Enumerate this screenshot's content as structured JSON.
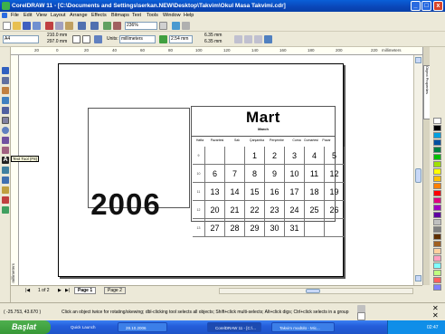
{
  "window": {
    "title": "CorelDRAW 11 - [C:\\Documents and Settings\\serkan.NEW\\Desktop\\Takvim\\Okul Masa Takvimi.cdr]",
    "minimize": "_",
    "maximize": "□",
    "close": "x"
  },
  "menu": [
    "File",
    "Edit",
    "View",
    "Layout",
    "Arrange",
    "Effects",
    "Bitmaps",
    "Text",
    "Tools",
    "Window",
    "Help"
  ],
  "toolbar": {
    "zoom": "236%",
    "paper": "A4",
    "width": "210.0 mm",
    "height": "297.0 mm",
    "units_label": "Units:",
    "units_value": "millimeters",
    "nudge": "2.54 mm",
    "dup_x": "6.35 mm",
    "dup_y": "6.35 mm"
  },
  "ruler": {
    "h_labels": [
      "20",
      "0",
      "20",
      "40",
      "60",
      "80",
      "100",
      "120",
      "140",
      "160",
      "180",
      "200",
      "220"
    ],
    "unit": "millimeters",
    "v_label": "millimeters"
  },
  "calendar": {
    "month": "Mart",
    "month_sub": "March",
    "day_names": [
      "Hafta",
      "Pazartesi",
      "Salı",
      "Çarşamba",
      "Perşembe",
      "Cuma",
      "Cumartesi",
      "Pazar"
    ],
    "weeks": [
      {
        "week": "9",
        "days": [
          "",
          "",
          "1",
          "2",
          "3",
          "4",
          "5"
        ]
      },
      {
        "week": "10",
        "days": [
          "6",
          "7",
          "8",
          "9",
          "10",
          "11",
          "12"
        ]
      },
      {
        "week": "11",
        "days": [
          "13",
          "14",
          "15",
          "16",
          "17",
          "18",
          "19"
        ]
      },
      {
        "week": "12",
        "days": [
          "20",
          "21",
          "22",
          "23",
          "24",
          "25",
          "26"
        ]
      },
      {
        "week": "13",
        "days": [
          "27",
          "28",
          "29",
          "30",
          "31",
          "",
          ""
        ]
      }
    ]
  },
  "year": "2006",
  "tooltip": "Text Tool (F8)",
  "dockers_label": "Object Properties",
  "pages": {
    "counter": "1 of 2",
    "tabs": [
      "Page 1",
      "Page 2"
    ]
  },
  "status": {
    "coords": "( -25.753, 43.670 )",
    "hint": "Click an object twice for rotating/skewing; dbl-clicking tool selects all objects; Shift+click multi-selects; Alt+click digs; Ctrl+click selects in a group"
  },
  "taskbar": {
    "start": "Başlat",
    "items": [
      "Quick Launch",
      "28.10.2006",
      "CorelDRAW 11 - [C:\\...",
      "Takvim modülü - Mic..."
    ],
    "clock": "02:47"
  },
  "palette_colors": [
    "#ffffff",
    "#000000",
    "#00a0e0",
    "#0050a0",
    "#008040",
    "#00c000",
    "#a0e000",
    "#ffff00",
    "#ffc000",
    "#ff8000",
    "#ff0000",
    "#e00080",
    "#a000c0",
    "#6000a0",
    "#c0c0c0",
    "#808080",
    "#603000",
    "#a06020",
    "#ffd0a0",
    "#ffa0c0",
    "#80ffff",
    "#c0ff80",
    "#ff6060",
    "#8080ff"
  ]
}
